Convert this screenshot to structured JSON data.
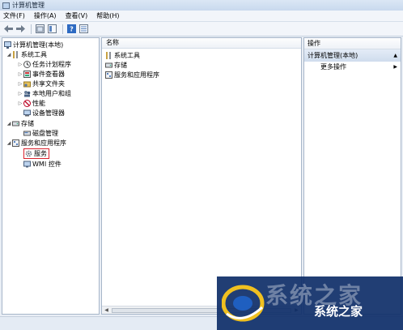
{
  "window": {
    "title": "计算机管理"
  },
  "menu": {
    "file": "文件(F)",
    "action": "操作(A)",
    "view": "查看(V)",
    "help": "帮助(H)"
  },
  "tree": {
    "root": "计算机管理(本地)",
    "system_tools": "系统工具",
    "task_scheduler": "任务计划程序",
    "event_viewer": "事件查看器",
    "shared_folders": "共享文件夹",
    "local_users": "本地用户和组",
    "performance": "性能",
    "device_manager": "设备管理器",
    "storage": "存储",
    "disk_management": "磁盘管理",
    "services_apps": "服务和应用程序",
    "services": "服务",
    "wmi": "WMI 控件"
  },
  "center": {
    "column_header": "名称",
    "items": [
      "系统工具",
      "存储",
      "服务和应用程序"
    ]
  },
  "actions": {
    "title": "操作",
    "section": "计算机管理(本地)",
    "more": "更多操作"
  },
  "watermark": {
    "text": "系统之家",
    "bg_glyphs": "系统之家"
  },
  "colors": {
    "highlight": "#d9232e",
    "watermark": "#0e2e68"
  }
}
